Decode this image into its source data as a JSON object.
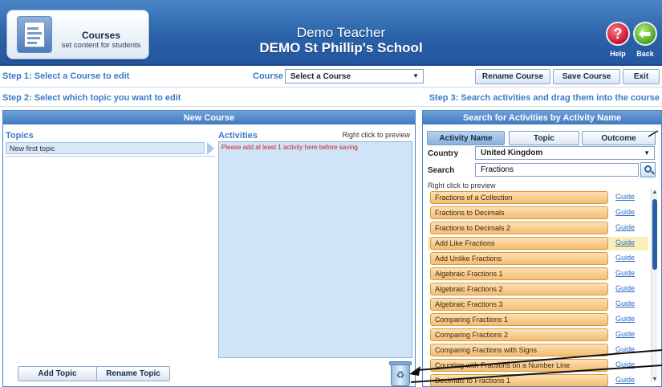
{
  "header": {
    "card_title": "Courses",
    "card_subtitle": "set content for students",
    "teacher_name": "Demo Teacher",
    "school_name": "DEMO St Phillip's School",
    "help_label": "Help",
    "back_label": "Back",
    "help_glyph": "?",
    "back_glyph": "⬅"
  },
  "toolbar": {
    "step1": "Step 1: Select a Course to edit",
    "course_label": "Course",
    "course_select_value": "Select a Course",
    "rename_course": "Rename Course",
    "save_course": "Save Course",
    "exit": "Exit",
    "step2": "Step 2: Select which topic you want to edit",
    "step3": "Step 3: Search activities and drag them into the course"
  },
  "left_panel": {
    "title": "New Course",
    "topics_header": "Topics",
    "topics": [
      "New first topic"
    ],
    "activities_header": "Activities",
    "preview_hint": "Right click to preview",
    "activities_message": "Please add at least 1 activity here before saving",
    "add_topic": "Add Topic",
    "rename_topic": "Rename Topic"
  },
  "right_panel": {
    "title": "Search for Activities by Activity Name",
    "tabs": [
      "Activity Name",
      "Topic",
      "Outcome"
    ],
    "country_label": "Country",
    "country_value": "United Kingdom",
    "search_label": "Search",
    "search_value": "Fractions",
    "results_hint": "Right click to preview",
    "guide_label": "Guide",
    "results": [
      "Fractions of a Collection",
      "Fractions to Decimals",
      "Fractions to Decimals 2",
      "Add Like Fractions",
      "Add Unlike Fractions",
      "Algebraic Fractions 1",
      "Algebraic Fractions 2",
      "Algebraic Fractions 3",
      "Comparing Fractions 1",
      "Comparing Fractions 2",
      "Comparing Fractions with Signs",
      "Counting with Fractions on a Number Line",
      "Decimals to Fractions 1"
    ],
    "highlighted_result": "Add Like Fractions"
  },
  "colors": {
    "header_blue": "#2b62a8",
    "step_text": "#3a7bc8",
    "result_chip": "#f4bd72",
    "warning_text": "#d12020"
  }
}
